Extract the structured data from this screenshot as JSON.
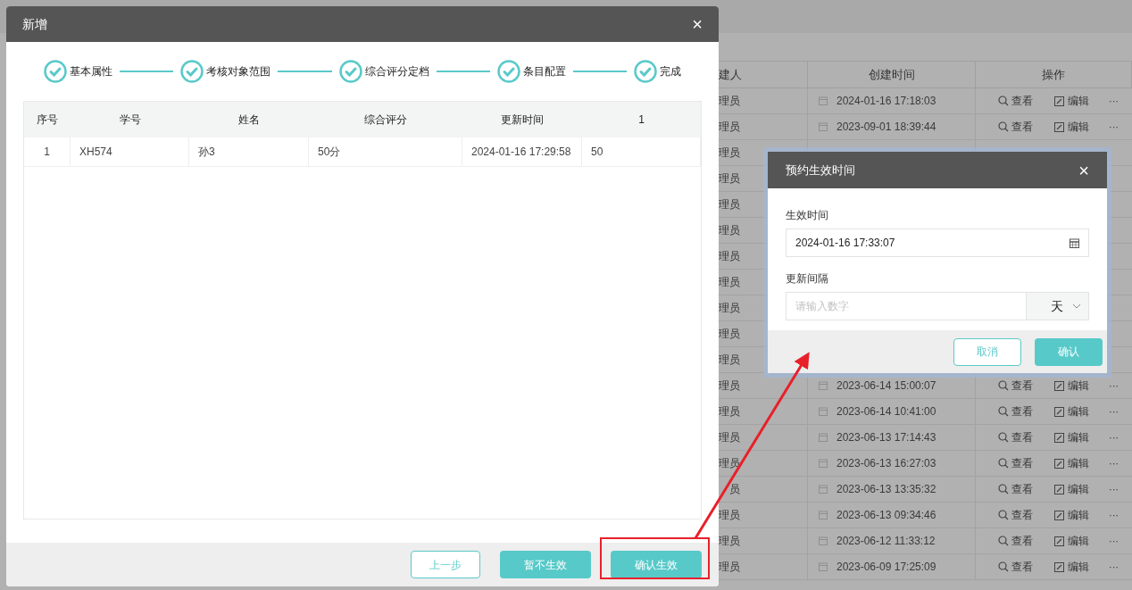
{
  "background_table": {
    "columns": [
      "建人",
      "创建时间",
      "操作"
    ],
    "rows": [
      {
        "creator": "理员",
        "created": "2024-01-16 17:18:03",
        "view": "查看",
        "edit": "编辑",
        "more": "···"
      },
      {
        "creator": "理员",
        "created": "2023-09-01 18:39:44",
        "view": "查看",
        "edit": "编辑",
        "more": "···"
      },
      {
        "creator": "理员"
      },
      {
        "creator": "理员"
      },
      {
        "creator": "理员"
      },
      {
        "creator": "理员"
      },
      {
        "creator": "理员"
      },
      {
        "creator": "理员"
      },
      {
        "creator": "理员"
      },
      {
        "creator": "理员"
      },
      {
        "creator": "理员"
      },
      {
        "creator": "理员",
        "created": "2023-06-14 15:00:07",
        "view": "查看",
        "edit": "编辑",
        "more": "···"
      },
      {
        "creator": "理员",
        "created": "2023-06-14 10:41:00",
        "view": "查看",
        "edit": "编辑",
        "more": "···"
      },
      {
        "creator": "理员",
        "created": "2023-06-13 17:14:43",
        "view": "查看",
        "edit": "编辑",
        "more": "···"
      },
      {
        "creator": "理员",
        "created": "2023-06-13 16:27:03",
        "view": "查看",
        "edit": "编辑",
        "more": "···"
      },
      {
        "creator": "员",
        "created": "2023-06-13 13:35:32",
        "view": "查看",
        "edit": "编辑",
        "more": "···"
      },
      {
        "creator": "理员",
        "created": "2023-06-13 09:34:46",
        "view": "查看",
        "edit": "编辑",
        "more": "···"
      },
      {
        "creator": "理员",
        "created": "2023-06-12 11:33:12",
        "view": "查看",
        "edit": "编辑",
        "more": "···"
      },
      {
        "creator": "理员",
        "created": "2023-06-09 17:25:09",
        "view": "查看",
        "edit": "编辑",
        "more": "···"
      }
    ]
  },
  "main_dialog": {
    "title": "新增",
    "close": "×",
    "steps": [
      {
        "label": "基本属性",
        "done": true
      },
      {
        "label": "考核对象范围",
        "done": true
      },
      {
        "label": "综合评分定档",
        "done": true
      },
      {
        "label": "条目配置",
        "done": true
      },
      {
        "label": "完成",
        "done": true
      }
    ],
    "table": {
      "columns": [
        "序号",
        "学号",
        "姓名",
        "综合评分",
        "更新时间",
        "1"
      ],
      "rows": [
        [
          "1",
          "XH574",
          "孙3",
          "50分",
          "2024-01-16 17:29:58",
          "50"
        ]
      ]
    },
    "buttons": [
      {
        "label": "上一步",
        "kind": "outline"
      },
      {
        "label": "暂不生效",
        "kind": "primary"
      },
      {
        "label": "确认生效",
        "kind": "primary",
        "highlighted": true
      }
    ]
  },
  "schedule_dialog": {
    "title": "预约生效时间",
    "close": "×",
    "fields": [
      {
        "label": "生效时间",
        "kind": "date",
        "value": "2024-01-16 17:33:07"
      },
      {
        "label": "更新间隔",
        "kind": "number",
        "placeholder": "请输入数字",
        "unit": "天"
      }
    ],
    "buttons": [
      {
        "label": "取消",
        "kind": "outline"
      },
      {
        "label": "确认",
        "kind": "primary"
      }
    ]
  }
}
